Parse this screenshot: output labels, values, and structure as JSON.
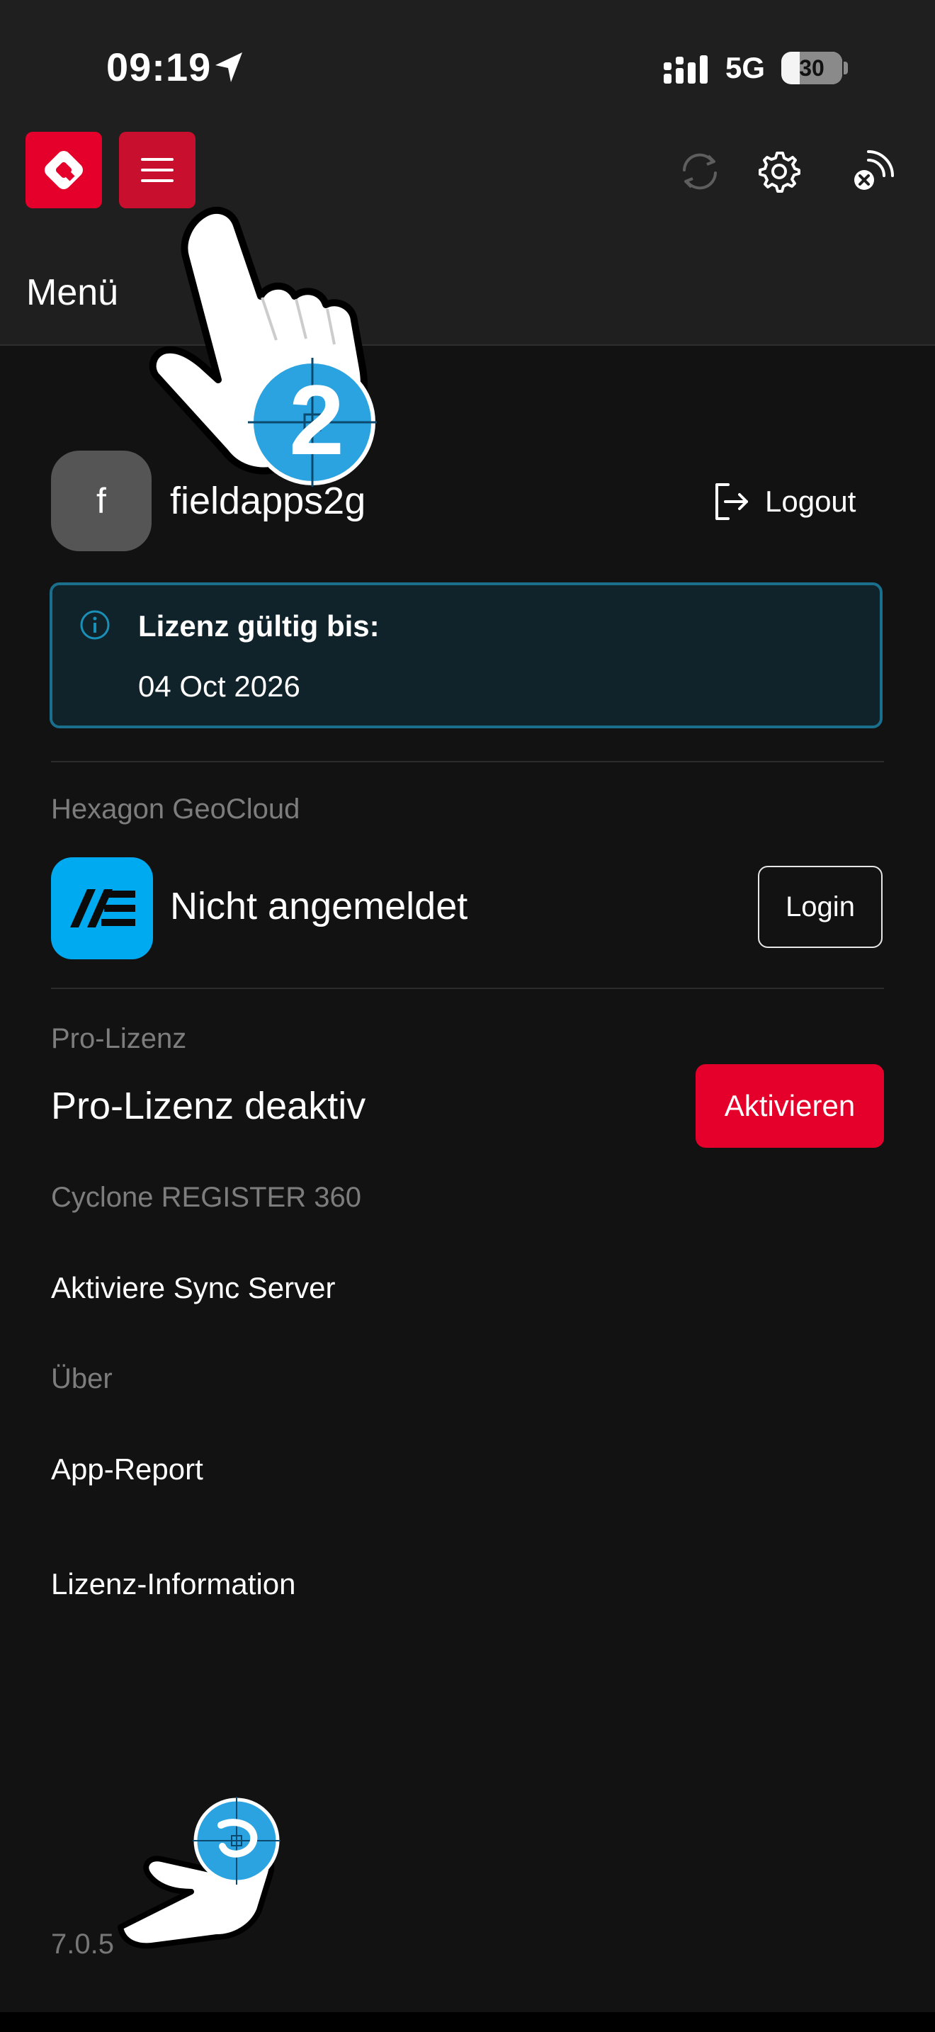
{
  "status_bar": {
    "time": "09:19",
    "network": "5G",
    "battery_percent": "30",
    "battery_level": 0.3
  },
  "toolbar": {
    "accent_color": "#e5002b",
    "icons": [
      "app-logo-icon",
      "hamburger-menu-icon",
      "sync-icon",
      "settings-gear-icon",
      "disconnected-signal-icon"
    ]
  },
  "header": {
    "title": "Menü"
  },
  "user": {
    "avatar_letter": "f",
    "name": "fieldapps2g",
    "logout_label": "Logout"
  },
  "license": {
    "title": "Lizenz gültig bis:",
    "date": "04 Oct 2026",
    "border_color": "#1a6f8c"
  },
  "geocloud": {
    "section_label": "Hexagon GeoCloud",
    "status": "Nicht angemeldet",
    "login_label": "Login",
    "logo_color": "#00aaf0"
  },
  "pro_license": {
    "section_label": "Pro-Lizenz",
    "status": "Pro-Lizenz deaktiv",
    "activate_label": "Aktivieren"
  },
  "cyclone": {
    "section_label": "Cyclone REGISTER 360",
    "sync_label": "Aktiviere Sync Server"
  },
  "about": {
    "section_label": "Über",
    "app_report_label": "App-Report",
    "license_info_label": "Lizenz-Information"
  },
  "version": "7.0.5",
  "overlay": {
    "tap_step_number": "2"
  }
}
